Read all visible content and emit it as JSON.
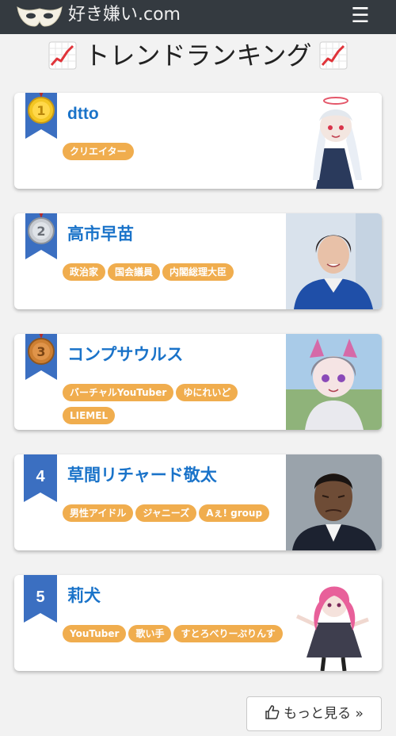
{
  "header": {
    "logo_text": "好き嫌い.com",
    "menu_icon": "☰"
  },
  "page": {
    "title": "トレンドランキング"
  },
  "ranking": [
    {
      "rank": "1",
      "badge": "gold-medal",
      "name": "dtto",
      "tags": [
        "クリエイター"
      ]
    },
    {
      "rank": "2",
      "badge": "silver-medal",
      "name": "高市早苗",
      "tags": [
        "政治家",
        "国会議員",
        "内閣総理大臣"
      ]
    },
    {
      "rank": "3",
      "badge": "bronze-medal",
      "name": "コンプサウルス",
      "tags": [
        "バーチャルYouTuber",
        "ゆにれいど",
        "LIEMEL"
      ]
    },
    {
      "rank": "4",
      "badge": "blue-ribbon",
      "name": "草間リチャード敬太",
      "tags": [
        "男性アイドル",
        "ジャニーズ",
        "Aぇ! group"
      ]
    },
    {
      "rank": "5",
      "badge": "blue-ribbon",
      "name": "莉犬",
      "tags": [
        "YouTuber",
        "歌い手",
        "すとろべりーぷりんす"
      ]
    }
  ],
  "more_button": {
    "label": "もっと見る »"
  },
  "colors": {
    "navbar": "#343a40",
    "name_link": "#1a73c9",
    "tag": "#f0ad4e",
    "ribbon": "#3b6fc1"
  }
}
